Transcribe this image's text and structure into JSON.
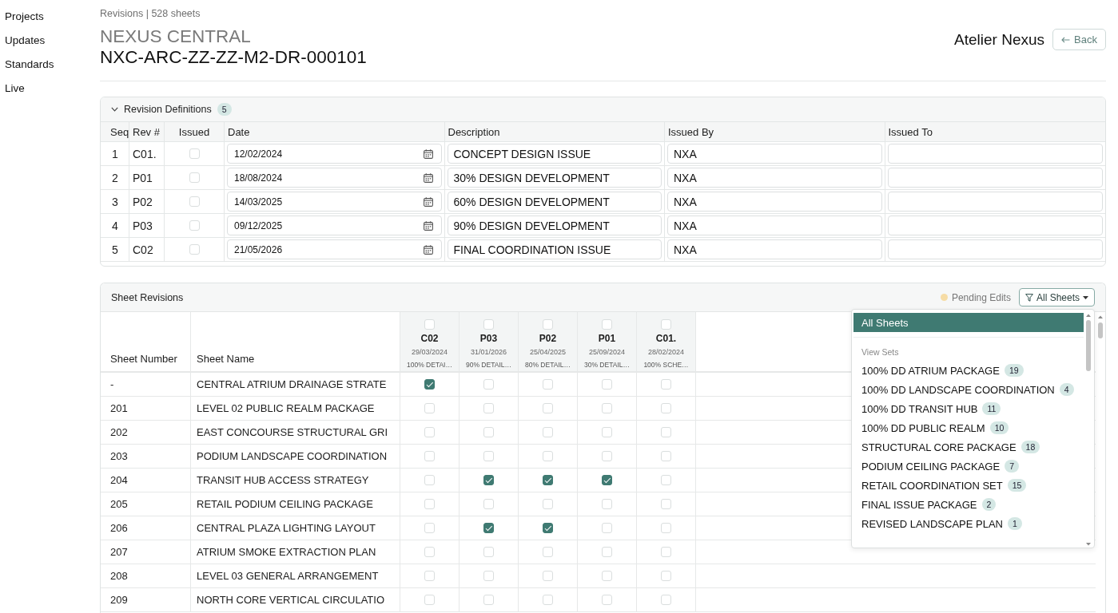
{
  "sidebar": {
    "items": [
      {
        "label": "Projects"
      },
      {
        "label": "Updates"
      },
      {
        "label": "Standards"
      },
      {
        "label": "Live"
      }
    ]
  },
  "header": {
    "subtitle": "Revisions | 528 sheets",
    "project": "NEXUS CENTRAL",
    "drawing_number": "NXC-ARC-ZZ-ZZ-M2-DR-000101",
    "organization": "Atelier Nexus",
    "back_button": "Back"
  },
  "revision_definitions": {
    "title": "Revision Definitions",
    "count": "5",
    "expanded": true,
    "columns": [
      "Seq",
      "Rev #",
      "Issued",
      "Date",
      "Description",
      "Issued By",
      "Issued To"
    ],
    "rows": [
      {
        "seq": "1",
        "rev": "C01.",
        "issued": false,
        "date": "12/02/2024",
        "description": "CONCEPT DESIGN ISSUE",
        "issued_by": "NXA"
      },
      {
        "seq": "2",
        "rev": "P01",
        "issued": false,
        "date": "18/08/2024",
        "description": "30% DESIGN DEVELOPMENT",
        "issued_by": "NXA"
      },
      {
        "seq": "3",
        "rev": "P02",
        "issued": false,
        "date": "14/03/2025",
        "description": "60% DESIGN DEVELOPMENT",
        "issued_by": "NXA"
      },
      {
        "seq": "4",
        "rev": "P03",
        "issued": false,
        "date": "09/12/2025",
        "description": "90% DESIGN DEVELOPMENT",
        "issued_by": "NXA"
      },
      {
        "seq": "5",
        "rev": "C02",
        "issued": false,
        "date": "21/05/2026",
        "description": "FINAL COORDINATION ISSUE",
        "issued_by": "NXA"
      }
    ]
  },
  "sheet_revisions": {
    "title": "Sheet Revisions",
    "pending_label": "Pending Edits",
    "filter_button": "All Sheets",
    "columns": [
      "Sheet Number",
      "Sheet Name"
    ],
    "revisions": [
      {
        "code": "C02",
        "date": "29/03/2024",
        "description": "100% DETAI…",
        "checked": false
      },
      {
        "code": "P03",
        "date": "31/01/2026",
        "description": "90% DETAIL…",
        "checked": false
      },
      {
        "code": "P02",
        "date": "25/04/2025",
        "description": "80% DETAIL…",
        "checked": false
      },
      {
        "code": "P01",
        "date": "25/09/2024",
        "description": "30% DETAIL…",
        "checked": false
      },
      {
        "code": "C01.",
        "date": "28/02/2024",
        "description": "100% SCHE…",
        "checked": false
      }
    ],
    "rows": [
      {
        "number": "-",
        "name": "CENTRAL ATRIUM DRAINAGE STRATE",
        "cells": [
          {
            "checked": true
          },
          {
            "checked": false
          },
          {
            "checked": false
          },
          {
            "checked": false
          },
          {
            "checked": false
          }
        ]
      },
      {
        "number": "201",
        "name": "LEVEL 02 PUBLIC REALM PACKAGE",
        "cells": [
          {
            "checked": false
          },
          {
            "checked": false
          },
          {
            "checked": false
          },
          {
            "checked": false
          },
          {
            "checked": false
          }
        ]
      },
      {
        "number": "202",
        "name": "EAST CONCOURSE STRUCTURAL GRI",
        "cells": [
          {
            "checked": false
          },
          {
            "checked": false
          },
          {
            "checked": false
          },
          {
            "checked": false
          },
          {
            "checked": false
          }
        ]
      },
      {
        "number": "203",
        "name": "PODIUM LANDSCAPE COORDINATION",
        "cells": [
          {
            "checked": false
          },
          {
            "checked": false
          },
          {
            "checked": false
          },
          {
            "checked": false
          },
          {
            "checked": false
          }
        ]
      },
      {
        "number": "204",
        "name": "TRANSIT HUB ACCESS STRATEGY",
        "cells": [
          {
            "checked": false
          },
          {
            "checked": true
          },
          {
            "checked": true
          },
          {
            "checked": true
          },
          {
            "checked": false
          }
        ]
      },
      {
        "number": "205",
        "name": "RETAIL PODIUM CEILING PACKAGE",
        "cells": [
          {
            "checked": false
          },
          {
            "checked": false
          },
          {
            "checked": false
          },
          {
            "checked": false
          },
          {
            "checked": false
          }
        ]
      },
      {
        "number": "206",
        "name": "CENTRAL PLAZA LIGHTING LAYOUT",
        "cells": [
          {
            "checked": false
          },
          {
            "checked": true
          },
          {
            "checked": true
          },
          {
            "checked": false
          },
          {
            "checked": false
          }
        ]
      },
      {
        "number": "207",
        "name": "ATRIUM SMOKE EXTRACTION PLAN",
        "cells": [
          {
            "checked": false
          },
          {
            "checked": false
          },
          {
            "checked": false
          },
          {
            "checked": false
          },
          {
            "checked": false
          }
        ]
      },
      {
        "number": "208",
        "name": "LEVEL 03 GENERAL ARRANGEMENT",
        "cells": [
          {
            "checked": false
          },
          {
            "checked": false
          },
          {
            "checked": false
          },
          {
            "checked": false
          },
          {
            "checked": false
          }
        ]
      },
      {
        "number": "209",
        "name": "NORTH CORE VERTICAL CIRCULATIO",
        "cells": [
          {
            "checked": false
          },
          {
            "checked": false
          },
          {
            "checked": false
          },
          {
            "checked": false
          },
          {
            "checked": false
          }
        ]
      }
    ]
  },
  "filter_menu": {
    "options": [
      {
        "label": "All Sheets",
        "selected": true
      }
    ],
    "group_label": "View Sets",
    "items": [
      {
        "label": "100% DD ATRIUM PACKAGE",
        "count": "19",
        "selected": false
      },
      {
        "label": "100% DD LANDSCAPE COORDINATION",
        "count": "4",
        "selected": false
      },
      {
        "label": "100% DD TRANSIT HUB",
        "count": "11",
        "selected": false
      },
      {
        "label": "100% DD PUBLIC REALM",
        "count": "10",
        "selected": false
      },
      {
        "label": "STRUCTURAL CORE PACKAGE",
        "count": "18",
        "selected": false
      },
      {
        "label": "PODIUM CEILING PACKAGE",
        "count": "7",
        "selected": false
      },
      {
        "label": "RETAIL COORDINATION SET",
        "count": "15",
        "selected": false
      },
      {
        "label": "FINAL ISSUE PACKAGE",
        "count": "2",
        "selected": false
      },
      {
        "label": "REVISED LANDSCAPE PLAN",
        "count": "1",
        "selected": false
      }
    ]
  }
}
